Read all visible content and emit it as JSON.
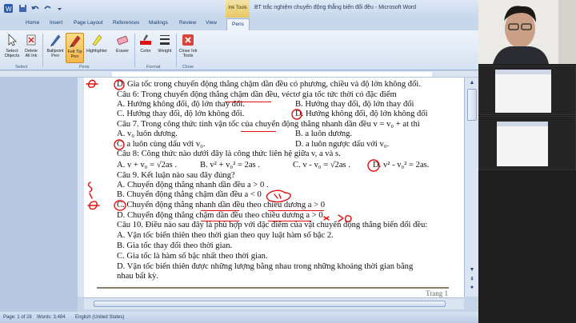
{
  "word": {
    "doc_title": "BT trắc nghiệm chuyển động thẳng biến đổi đều - Microsoft Word",
    "context_tab": "Ink Tools",
    "tabs": [
      "Home",
      "Insert",
      "Page Layout",
      "References",
      "Mailings",
      "Review",
      "View",
      "Pens"
    ],
    "active_tab": "Pens",
    "ribbon": {
      "select_objects": "Select Objects",
      "delete_all_ink": "Delete All Ink",
      "ballpoint_pen": "Ballpoint Pen",
      "felt_tip_pen": "Felt Tip Pen",
      "highlighter": "Highlighter",
      "eraser": "Eraser",
      "color": "Color",
      "weight": "Weight",
      "close_ink_tools": "Close Ink Tools",
      "group_select": "Select",
      "group_pens": "Pens",
      "group_format": "Format",
      "group_close": "Close"
    },
    "ink_color": "#e01010",
    "page": {
      "lines": [
        "D. Gia tốc trong chuyển động thẳng chậm dần đều có phương, chiều và độ lớn không đổi.",
        "Câu 6: Trong chuyển động thẳng chậm dần đều, véctơ gia tốc tức thời có đặc điểm",
        "A. Hướng không đổi, độ lớn thay đổi.",
        "B. Hướng thay đổi, độ lớn thay đổi",
        "C. Hướng thay đổi, độ lớn không đổi.",
        "D. Hướng không đổi, độ lớn không đổi",
        "Câu 7. Trong công thức tính vận tốc của chuyển động thẳng nhanh dần đều v = v₀ + at thì",
        "A. v₀ luôn dương.",
        "B. a luôn dương.",
        "C. a luôn cùng dấu với v₀.",
        "D. a luôn ngược dấu với v₀.",
        "Câu 8: Công thức nào dưới đây là công thức liên hệ giữa v, a và s.",
        "A. v + v₀ = √2as .",
        "B. v² + v₀² = 2as .",
        "C. v - v₀ = √2as .",
        "D. v² - v₀² = 2as.",
        "Câu 9. Kết luận nào sau đây đúng?",
        "A. Chuyển động thẳng nhanh dần đều a > 0 .",
        "B. Chuyển động thẳng chậm dần đều a < 0",
        "C. Chuyển động thẳng nhanh dần đều theo chiều dương a > 0",
        "D. Chuyển động thẳng chậm dần đều theo chiều dương a > 0.",
        "Câu 10. Điều nào sau đây là phù hợp với đặc điểm của vật chuyển động thẳng biến đổi đều:",
        "A. Vận tốc biến thiên theo thời gian theo quy luật hàm số bậc 2.",
        "B. Gia tốc thay đổi theo thời gian.",
        "C. Gia tốc là hàm số bậc nhất theo thời gian.",
        "D. Vận tốc biến thiên được những lượng bằng nhau trong những khoảng thời gian bằng",
        "nhau bất kỳ."
      ],
      "page_label": "Trang 1"
    },
    "status": {
      "page": "Page: 1 of 28",
      "words": "Words: 3,484",
      "language": "English (United States)"
    }
  }
}
